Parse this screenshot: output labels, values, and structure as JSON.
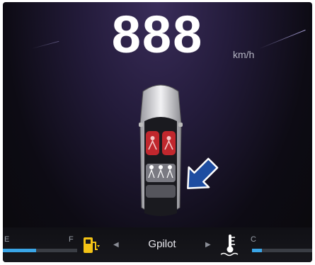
{
  "speed": {
    "value": "888",
    "unit": "km/h"
  },
  "seat_occupancy": {
    "front_left": "unbelted",
    "front_right": "unbelted",
    "rear_left": "belted",
    "rear_center": "belted",
    "rear_right": "belted"
  },
  "fuel": {
    "full_label": "F",
    "empty_label": "E",
    "level": 0.45,
    "icon": "fuel-pump-icon"
  },
  "mode": {
    "label": "Gpilot",
    "left_arrow": "◀",
    "right_arrow": "▶"
  },
  "coolant": {
    "cold_label": "C",
    "level": 0.15,
    "icon": "coolant-temperature-icon"
  },
  "colors": {
    "warning_red": "#c1272d",
    "fuel_yellow": "#f3c316",
    "gauge_blue": "#3aa5e6",
    "pointer_blue": "#1e4da1"
  }
}
